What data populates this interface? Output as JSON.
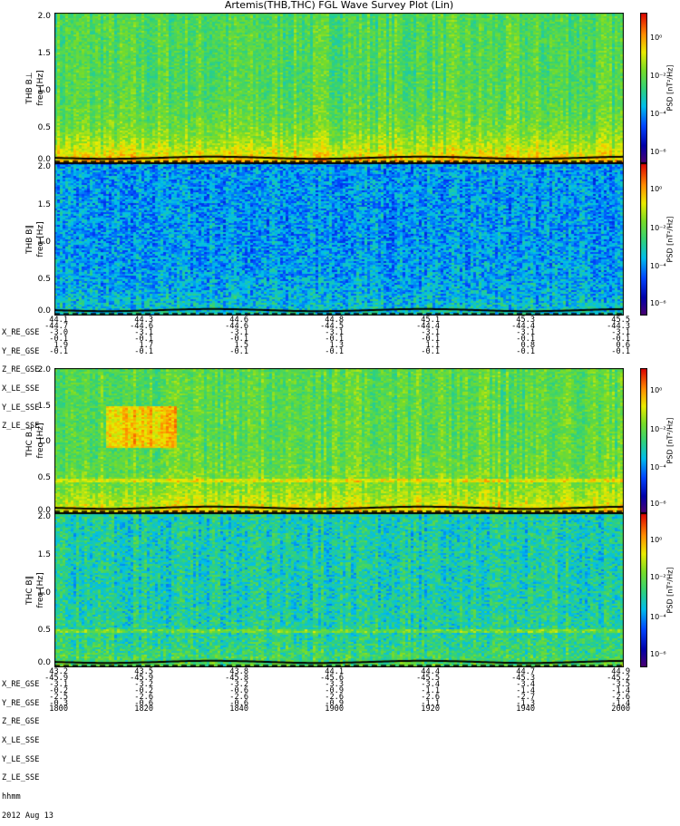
{
  "title": "Artemis(THB,THC) FGL Wave Survey Plot (Lin)",
  "chart_data": [
    {
      "type": "heatmap",
      "panel": "THB B_L",
      "ylabel_top": "THB B⊥",
      "ylabel_bottom": "freq [Hz]",
      "ylim": [
        0.0,
        2.0
      ],
      "yticks": [
        "2.0",
        "1.5",
        "1.0",
        "0.5",
        "0.0"
      ],
      "colorbar_label": "PSD [nT²/Hz]",
      "colorbar_ticks": [
        "10⁰",
        "10⁻²",
        "10⁻⁴",
        "10⁻⁶"
      ]
    },
    {
      "type": "heatmap",
      "panel": "THB B_par",
      "ylabel_top": "THB B∥",
      "ylabel_bottom": "freq [Hz]",
      "ylim": [
        0.0,
        2.0
      ],
      "yticks": [
        "2.0",
        "1.5",
        "1.0",
        "0.5",
        "0.0"
      ],
      "colorbar_label": "PSD [nT²/Hz]",
      "colorbar_ticks": [
        "10⁰",
        "10⁻²",
        "10⁻⁴",
        "10⁻⁶"
      ]
    },
    {
      "type": "heatmap",
      "panel": "THC B_L",
      "ylabel_top": "THC B⊥",
      "ylabel_bottom": "freq [Hz]",
      "ylim": [
        0.0,
        2.0
      ],
      "yticks": [
        "2.0",
        "1.5",
        "1.0",
        "0.5",
        "0.0"
      ],
      "colorbar_label": "PSD [nT²/Hz]",
      "colorbar_ticks": [
        "10⁰",
        "10⁻²",
        "10⁻⁴",
        "10⁻⁶"
      ]
    },
    {
      "type": "heatmap",
      "panel": "THC B_par",
      "ylabel_top": "THC B∥",
      "ylabel_bottom": "freq [Hz]",
      "ylim": [
        0.0,
        2.0
      ],
      "yticks": [
        "2.0",
        "1.5",
        "1.0",
        "0.5",
        "0.0"
      ],
      "colorbar_label": "PSD [nT²/Hz]",
      "colorbar_ticks": [
        "10⁰",
        "10⁻²",
        "10⁻⁴",
        "10⁻⁶"
      ]
    }
  ],
  "ephem_thb": {
    "labels": [
      "X_RE_GSE",
      "Y_RE_GSE",
      "Z_RE_GSE",
      "X_LE_SSE",
      "Y_LE_SSE",
      "Z_LE_SSE"
    ],
    "columns": [
      [
        "44.1",
        "-44.7",
        "-3.0",
        "-0.1",
        "1.9",
        "-0.1"
      ],
      [
        "44.3",
        "-44.6",
        "-3.1",
        "-0.1",
        "1.7",
        "-0.1"
      ],
      [
        "44.6",
        "-44.6",
        "-3.1",
        "-0.1",
        "1.5",
        "-0.1"
      ],
      [
        "44.8",
        "-44.5",
        "-3.1",
        "-0.1",
        "1.3",
        "-0.1"
      ],
      [
        "45.1",
        "-44.4",
        "-3.1",
        "-0.1",
        "1.1",
        "-0.1"
      ],
      [
        "45.3",
        "-44.4",
        "-3.1",
        "-0.1",
        "0.8",
        "-0.1"
      ],
      [
        "45.5",
        "-44.3",
        "-3.1",
        "-0.1",
        "0.6",
        "-0.1"
      ]
    ]
  },
  "ephem_thc": {
    "labels": [
      "X_RE_GSE",
      "Y_RE_GSE",
      "Z_RE_GSE",
      "X_LE_SSE",
      "Y_LE_SSE",
      "Z_LE_SSE",
      "hhmm",
      "2012 Aug 13"
    ],
    "columns": [
      [
        "43.2",
        "-45.9",
        "-3.1",
        "-0.2",
        "-2.5",
        "-0.3",
        "1800"
      ],
      [
        "43.5",
        "-45.9",
        "-3.2",
        "-0.2",
        "-2.6",
        "-0.6",
        "1820"
      ],
      [
        "43.8",
        "-45.8",
        "-3.2",
        "-0.6",
        "-2.6",
        "-0.6",
        "1840"
      ],
      [
        "44.1",
        "-45.6",
        "-3.3",
        "-0.9",
        "-2.6",
        "-0.9",
        "1900"
      ],
      [
        "44.4",
        "-45.5",
        "-3.4",
        "-1.1",
        "-2.6",
        "-1.1",
        "1920"
      ],
      [
        "44.7",
        "-45.3",
        "-3.4",
        "-1.4",
        "-2.7",
        "-1.3",
        "1940"
      ],
      [
        "44.9",
        "-45.2",
        "-3.5",
        "-1.4",
        "-2.6",
        "-1.4",
        "2000"
      ]
    ]
  }
}
